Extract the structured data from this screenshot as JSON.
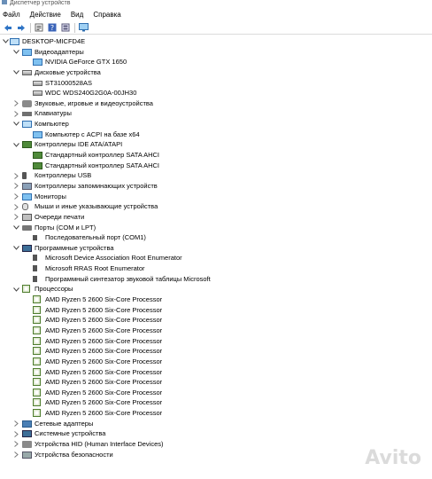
{
  "window": {
    "title": "Диспетчер устройств"
  },
  "menu": [
    "Файл",
    "Действие",
    "Вид",
    "Справка"
  ],
  "toolbar": [
    {
      "icon": "back-arrow-icon"
    },
    {
      "icon": "forward-arrow-icon"
    },
    {
      "icon": "properties-icon"
    },
    {
      "icon": "help-icon"
    },
    {
      "icon": "device-tree-icon"
    },
    {
      "icon": "monitor-icon"
    }
  ],
  "tree": [
    {
      "depth": 0,
      "expander": "expanded",
      "icon": "computer",
      "label": "DESKTOP-MICFD4E"
    },
    {
      "depth": 1,
      "expander": "expanded",
      "icon": "monitor",
      "label": "Видеоадаптеры"
    },
    {
      "depth": 2,
      "expander": "none",
      "icon": "monitor",
      "label": "NVIDIA GeForce GTX 1650"
    },
    {
      "depth": 1,
      "expander": "expanded",
      "icon": "disk",
      "label": "Дисковые устройства"
    },
    {
      "depth": 2,
      "expander": "none",
      "icon": "disk",
      "label": "ST31000528AS"
    },
    {
      "depth": 2,
      "expander": "none",
      "icon": "disk",
      "label": "WDC WDS240G2G0A-00JH30"
    },
    {
      "depth": 1,
      "expander": "collapsed",
      "icon": "sound",
      "label": "Звуковые, игровые и видеоустройства"
    },
    {
      "depth": 1,
      "expander": "collapsed",
      "icon": "keyboard",
      "label": "Клавиатуры"
    },
    {
      "depth": 1,
      "expander": "expanded",
      "icon": "computer",
      "label": "Компьютер"
    },
    {
      "depth": 2,
      "expander": "none",
      "icon": "monitor",
      "label": "Компьютер с ACPI на базе x64"
    },
    {
      "depth": 1,
      "expander": "expanded",
      "icon": "ide",
      "label": "Контроллеры IDE ATA/ATAPI"
    },
    {
      "depth": 2,
      "expander": "none",
      "icon": "ide",
      "label": "Стандартный контроллер SATA AHCI"
    },
    {
      "depth": 2,
      "expander": "none",
      "icon": "ide",
      "label": "Стандартный контроллер SATA AHCI"
    },
    {
      "depth": 1,
      "expander": "collapsed",
      "icon": "usb",
      "label": "Контроллеры USB"
    },
    {
      "depth": 1,
      "expander": "collapsed",
      "icon": "storage",
      "label": "Контроллеры запоминающих устройств"
    },
    {
      "depth": 1,
      "expander": "collapsed",
      "icon": "monitor",
      "label": "Мониторы"
    },
    {
      "depth": 1,
      "expander": "collapsed",
      "icon": "mouse",
      "label": "Мыши и иные указывающие устройства"
    },
    {
      "depth": 1,
      "expander": "collapsed",
      "icon": "printer",
      "label": "Очереди печати"
    },
    {
      "depth": 1,
      "expander": "expanded",
      "icon": "port",
      "label": "Порты (COM и LPT)"
    },
    {
      "depth": 2,
      "expander": "none",
      "icon": "portchild",
      "label": "Последовательный порт (COM1)"
    },
    {
      "depth": 1,
      "expander": "expanded",
      "icon": "system",
      "label": "Программные устройства"
    },
    {
      "depth": 2,
      "expander": "none",
      "icon": "systemchild",
      "label": "Microsoft Device Association Root Enumerator"
    },
    {
      "depth": 2,
      "expander": "none",
      "icon": "systemchild",
      "label": "Microsoft RRAS Root Enumerator"
    },
    {
      "depth": 2,
      "expander": "none",
      "icon": "systemchild",
      "label": "Программный синтезатор звуковой таблицы Microsoft"
    },
    {
      "depth": 1,
      "expander": "expanded",
      "icon": "cpu",
      "label": "Процессоры"
    },
    {
      "depth": 2,
      "expander": "none",
      "icon": "cpu",
      "label": "AMD Ryzen 5 2600 Six-Core Processor"
    },
    {
      "depth": 2,
      "expander": "none",
      "icon": "cpu",
      "label": "AMD Ryzen 5 2600 Six-Core Processor"
    },
    {
      "depth": 2,
      "expander": "none",
      "icon": "cpu",
      "label": "AMD Ryzen 5 2600 Six-Core Processor"
    },
    {
      "depth": 2,
      "expander": "none",
      "icon": "cpu",
      "label": "AMD Ryzen 5 2600 Six-Core Processor"
    },
    {
      "depth": 2,
      "expander": "none",
      "icon": "cpu",
      "label": "AMD Ryzen 5 2600 Six-Core Processor"
    },
    {
      "depth": 2,
      "expander": "none",
      "icon": "cpu",
      "label": "AMD Ryzen 5 2600 Six-Core Processor"
    },
    {
      "depth": 2,
      "expander": "none",
      "icon": "cpu",
      "label": "AMD Ryzen 5 2600 Six-Core Processor"
    },
    {
      "depth": 2,
      "expander": "none",
      "icon": "cpu",
      "label": "AMD Ryzen 5 2600 Six-Core Processor"
    },
    {
      "depth": 2,
      "expander": "none",
      "icon": "cpu",
      "label": "AMD Ryzen 5 2600 Six-Core Processor"
    },
    {
      "depth": 2,
      "expander": "none",
      "icon": "cpu",
      "label": "AMD Ryzen 5 2600 Six-Core Processor"
    },
    {
      "depth": 2,
      "expander": "none",
      "icon": "cpu",
      "label": "AMD Ryzen 5 2600 Six-Core Processor"
    },
    {
      "depth": 2,
      "expander": "none",
      "icon": "cpu",
      "label": "AMD Ryzen 5 2600 Six-Core Processor"
    },
    {
      "depth": 1,
      "expander": "collapsed",
      "icon": "net",
      "label": "Сетевые адаптеры"
    },
    {
      "depth": 1,
      "expander": "collapsed",
      "icon": "system",
      "label": "Системные устройства"
    },
    {
      "depth": 1,
      "expander": "collapsed",
      "icon": "hid",
      "label": "Устройства HID (Human Interface Devices)"
    },
    {
      "depth": 1,
      "expander": "collapsed",
      "icon": "security",
      "label": "Устройства безопасности"
    }
  ],
  "watermark": "Avito"
}
